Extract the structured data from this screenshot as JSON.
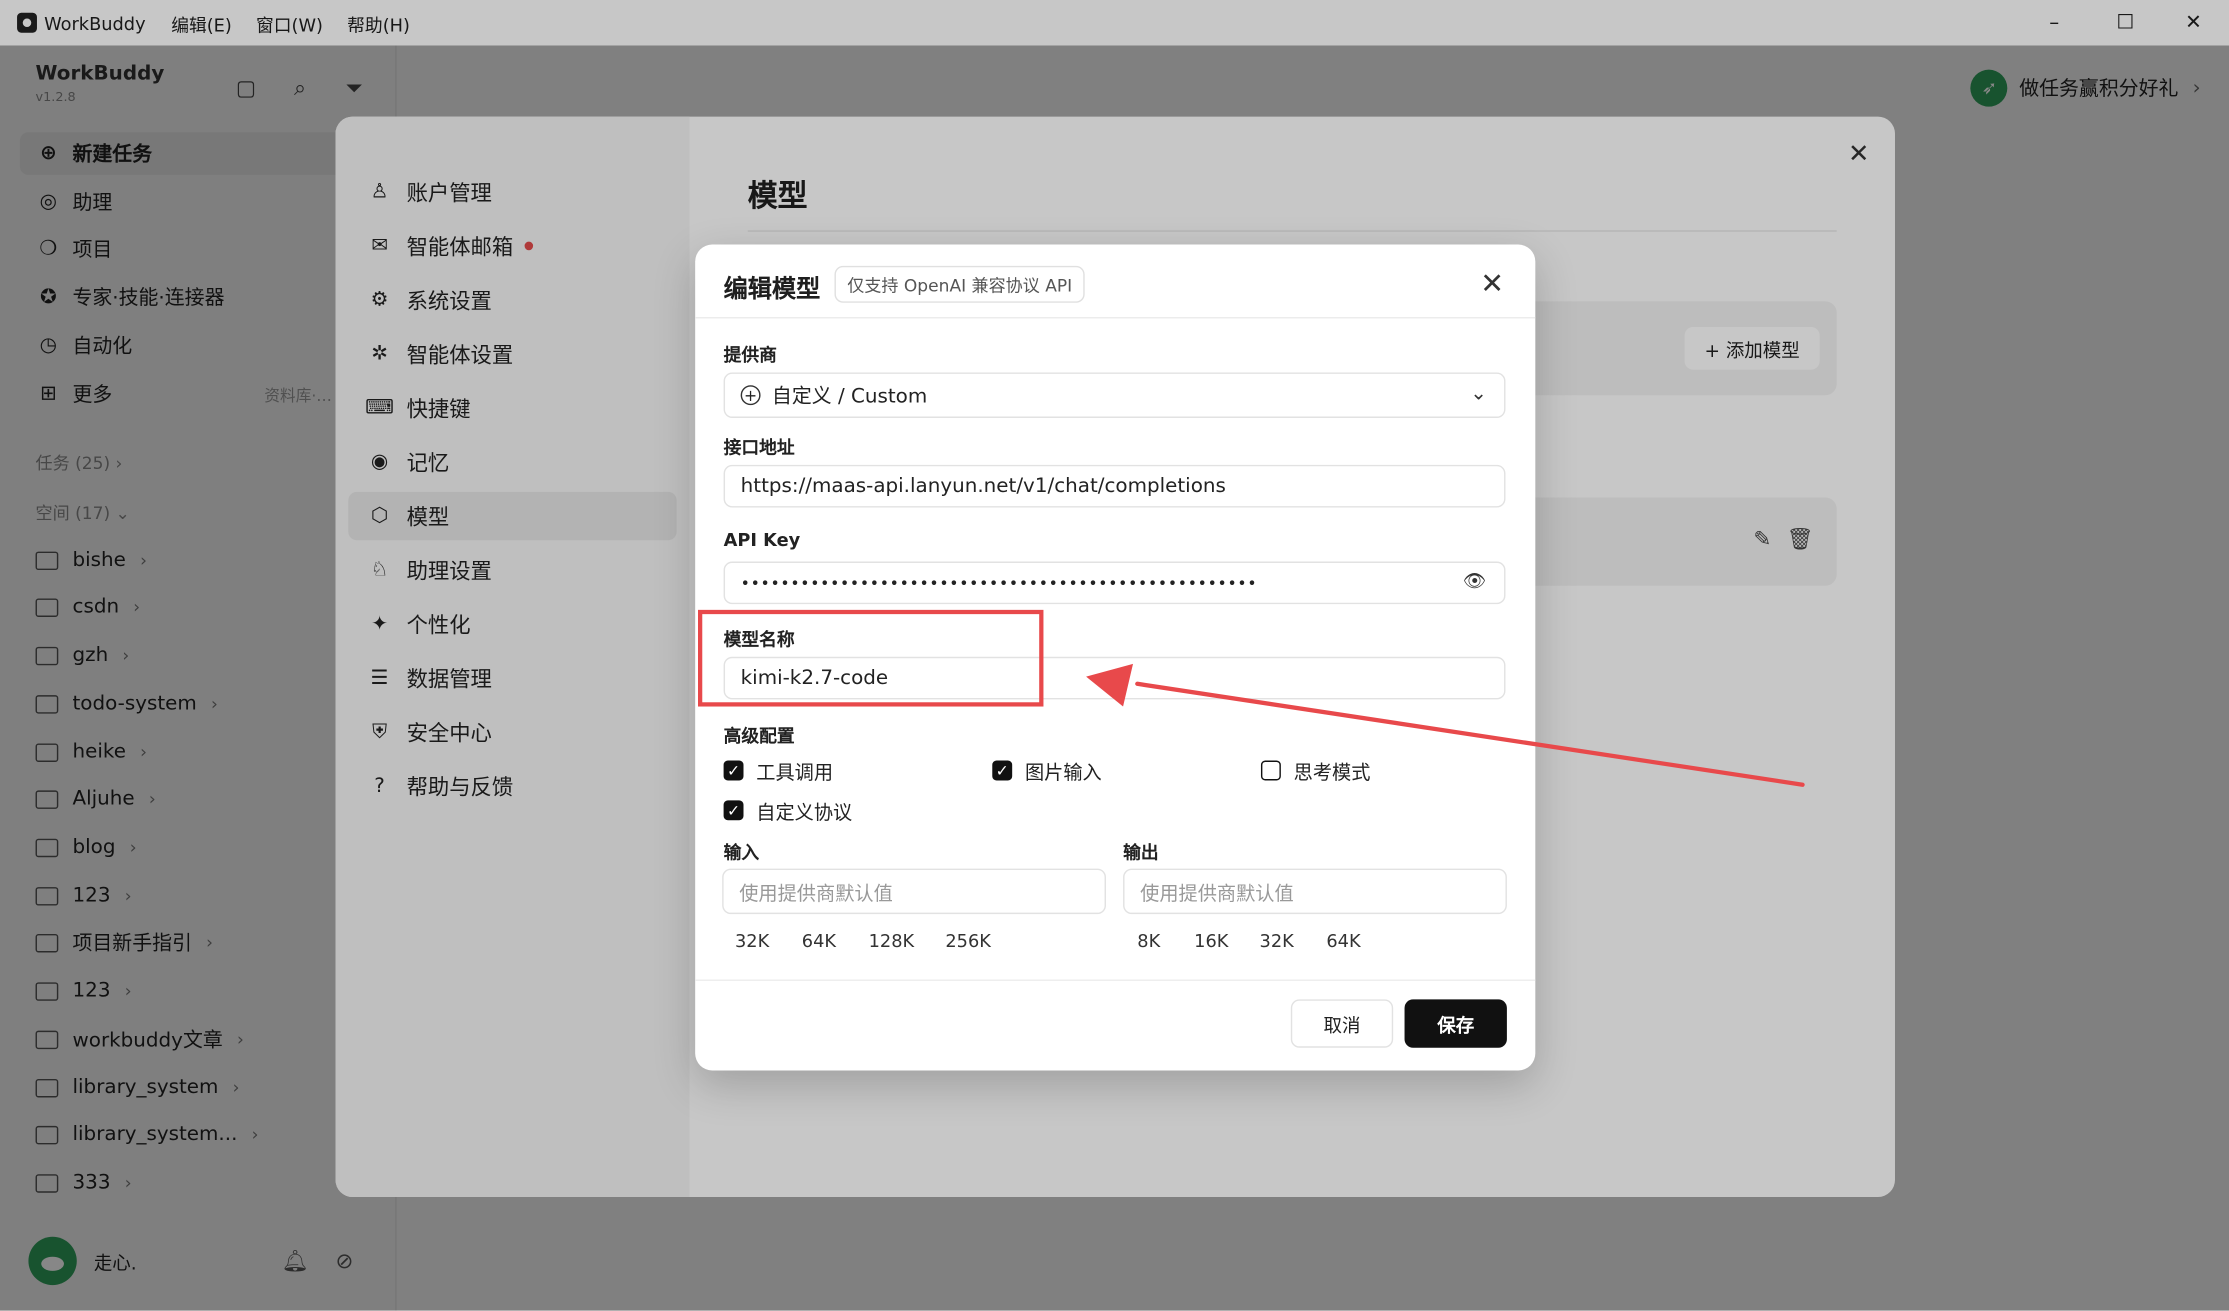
{
  "window": {
    "app_name": "WorkBuddy",
    "menu": [
      "编辑(E)",
      "窗口(W)",
      "帮助(H)"
    ],
    "controls": {
      "minimize": "–",
      "maximize": "☐",
      "close": "✕"
    }
  },
  "sidebar": {
    "brand": "WorkBuddy",
    "version": "v1.2.8",
    "nav": [
      {
        "label": "新建任务",
        "icon": "plus-circle-icon"
      },
      {
        "label": "助理",
        "icon": "assistant-icon"
      },
      {
        "label": "项目",
        "icon": "project-icon"
      },
      {
        "label": "专家·技能·连接器",
        "icon": "expert-icon"
      },
      {
        "label": "自动化",
        "icon": "clock-icon"
      },
      {
        "label": "更多",
        "icon": "grid-icon"
      }
    ],
    "more_hint": "资料库·…",
    "tasks_header": "任务 (25)",
    "spaces_header": "空间 (17)",
    "folders": [
      "bishe",
      "csdn",
      "gzh",
      "todo-system",
      "heike",
      "Aljuhe",
      "blog",
      "123",
      "项目新手指引",
      "123",
      "workbuddy文章",
      "library_system",
      "library_system...",
      "333"
    ],
    "user_name": "走心."
  },
  "header": {
    "reward": "做任务赢积分好礼"
  },
  "settings": {
    "nav": [
      {
        "label": "账户管理",
        "icon": "user-icon"
      },
      {
        "label": "智能体邮箱",
        "icon": "mail-icon"
      },
      {
        "label": "系统设置",
        "icon": "gear-icon"
      },
      {
        "label": "智能体设置",
        "icon": "puzzle-icon"
      },
      {
        "label": "快捷键",
        "icon": "keyboard-icon"
      },
      {
        "label": "记忆",
        "icon": "memory-icon"
      },
      {
        "label": "模型",
        "icon": "cube-icon"
      },
      {
        "label": "助理设置",
        "icon": "assistant-settings-icon"
      },
      {
        "label": "个性化",
        "icon": "sparkle-icon"
      },
      {
        "label": "数据管理",
        "icon": "database-icon"
      },
      {
        "label": "安全中心",
        "icon": "shield-icon"
      },
      {
        "label": "帮助与反馈",
        "icon": "help-icon"
      }
    ],
    "title": "模型",
    "add_model": "+ 添加模型"
  },
  "dialog": {
    "title": "编辑模型",
    "badge": "仅支持 OpenAI 兼容协议 API",
    "provider_label": "提供商",
    "provider_value": "自定义 / Custom",
    "endpoint_label": "接口地址",
    "endpoint_value": "https://maas-api.lanyun.net/v1/chat/completions",
    "apikey_label": "API Key",
    "apikey_value": "••••••••••••••••••••••••••••••••••••••••••••••••••••",
    "model_name_label": "模型名称",
    "model_name_value": "kimi-k2.7-code",
    "advanced_label": "高级配置",
    "options": [
      {
        "label": "工具调用",
        "checked": true
      },
      {
        "label": "图片输入",
        "checked": true
      },
      {
        "label": "思考模式",
        "checked": false
      },
      {
        "label": "自定义协议",
        "checked": true
      }
    ],
    "input_label": "输入",
    "output_label": "输出",
    "input_placeholder": "使用提供商默认值",
    "output_placeholder": "使用提供商默认值",
    "input_presets": [
      "32K",
      "64K",
      "128K",
      "256K"
    ],
    "output_presets": [
      "8K",
      "16K",
      "32K",
      "64K"
    ],
    "cancel": "取消",
    "save": "保存"
  },
  "colors": {
    "annotation": "#e8494b",
    "primary_button": "#111111",
    "reward_icon": "#2e9e5a"
  }
}
